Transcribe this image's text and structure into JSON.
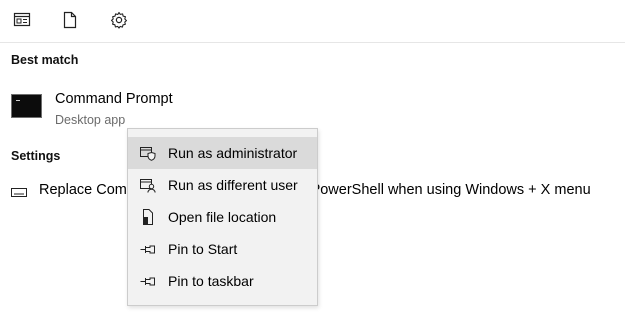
{
  "toolbar": {
    "icons": [
      "apps-icon",
      "documents-icon",
      "settings-icon"
    ]
  },
  "best_match": {
    "header": "Best match",
    "title": "Command Prompt",
    "subtitle": "Desktop app"
  },
  "settings": {
    "header": "Settings",
    "item_label": "Replace Command Prompt with Windows PowerShell when using Windows + X menu"
  },
  "context_menu": {
    "items": [
      {
        "label": "Run as administrator",
        "icon": "shield-icon"
      },
      {
        "label": "Run as different user",
        "icon": "user-icon"
      },
      {
        "label": "Open file location",
        "icon": "file-icon"
      },
      {
        "label": "Pin to Start",
        "icon": "pin-icon"
      },
      {
        "label": "Pin to taskbar",
        "icon": "pin-icon"
      }
    ],
    "highlighted_index": 0
  },
  "colors": {
    "menu_bg": "#f2f2f2",
    "menu_highlight": "#dadada",
    "subtext": "#6b6b6b"
  }
}
